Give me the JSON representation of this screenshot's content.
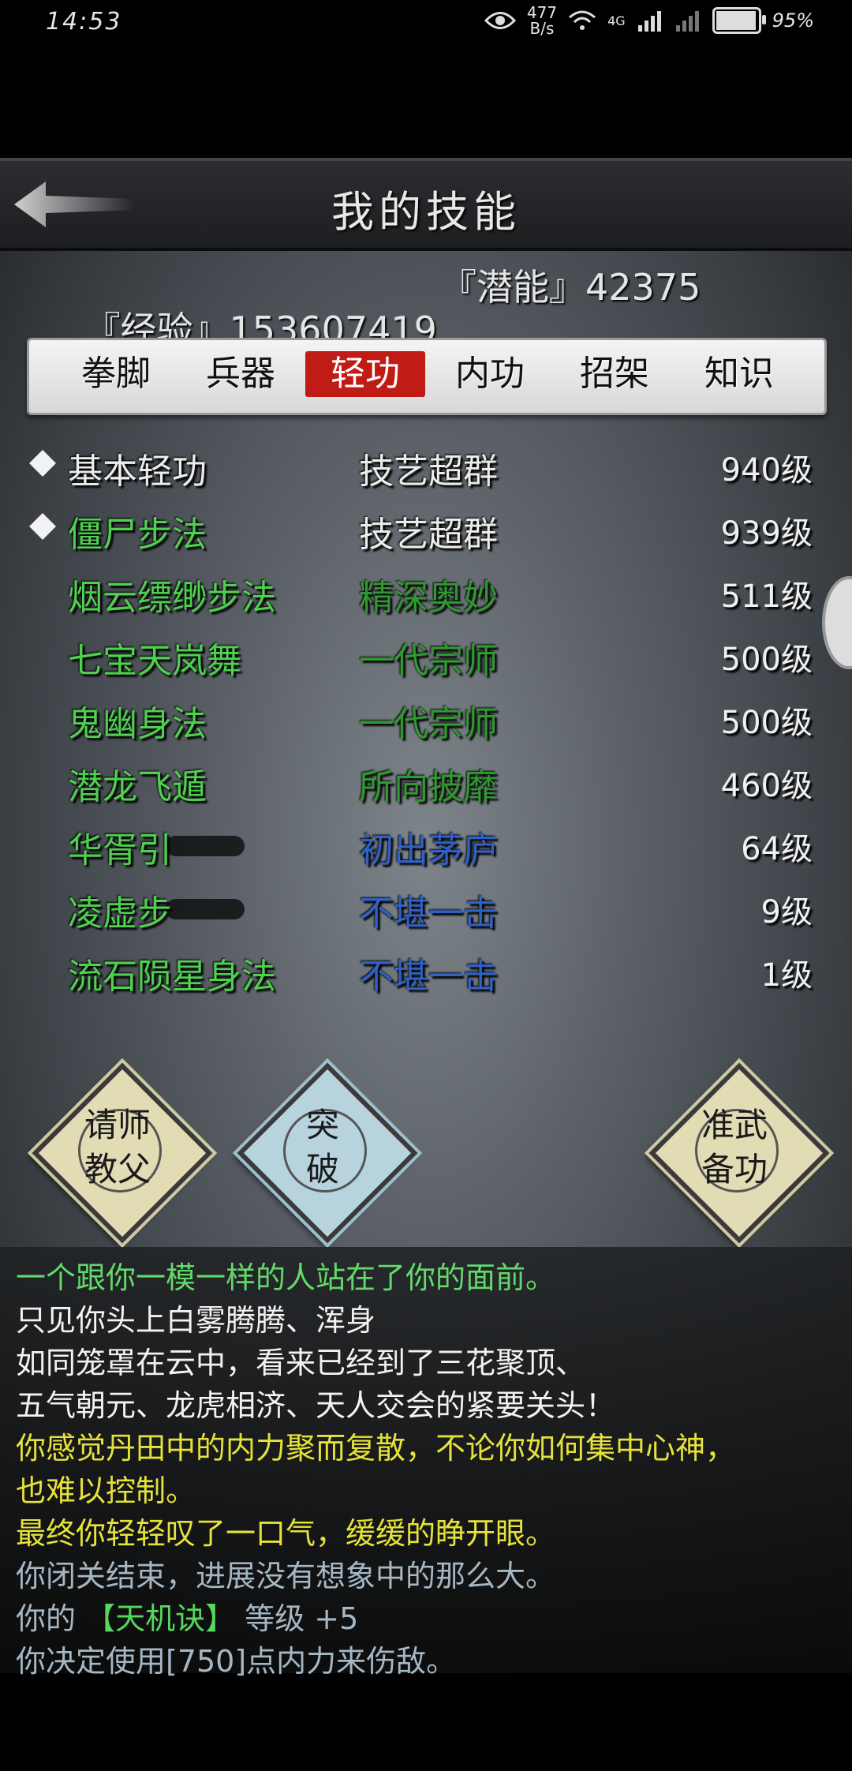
{
  "status_bar": {
    "time": "14:53",
    "net_speed": "477",
    "net_unit": "B/s",
    "signal": "4G",
    "battery": "95%",
    "battery_level": 0.95
  },
  "header": {
    "title": "我的技能"
  },
  "stats": {
    "exp": "『经验』153607419",
    "potential": "『潜能』42375"
  },
  "tabs": [
    {
      "label": "拳脚",
      "active": false
    },
    {
      "label": "兵器",
      "active": false
    },
    {
      "label": "轻功",
      "active": true
    },
    {
      "label": "内功",
      "active": false
    },
    {
      "label": "招架",
      "active": false
    },
    {
      "label": "知识",
      "active": false
    }
  ],
  "skills": [
    {
      "name": "基本轻功",
      "rank": "技艺超群",
      "level": "940级",
      "marked": true,
      "name_color": "white",
      "rank_color": "white"
    },
    {
      "name": "僵尸步法",
      "rank": "技艺超群",
      "level": "939级",
      "marked": true,
      "name_color": "green",
      "rank_color": "white"
    },
    {
      "name": "烟云缥缈步法",
      "rank": "精深奥妙",
      "level": "511级",
      "marked": false,
      "name_color": "green",
      "rank_color": "dgreen"
    },
    {
      "name": "七宝天岚舞",
      "rank": "一代宗师",
      "level": "500级",
      "marked": false,
      "name_color": "green",
      "rank_color": "dgreen"
    },
    {
      "name": "鬼幽身法",
      "rank": "一代宗师",
      "level": "500级",
      "marked": false,
      "name_color": "green",
      "rank_color": "dgreen"
    },
    {
      "name": "潜龙飞遁",
      "rank": "所向披靡",
      "level": "460级",
      "marked": false,
      "name_color": "green",
      "rank_color": "dgreen"
    },
    {
      "name": "华胥引",
      "rank": "初出茅庐",
      "level": "64级",
      "marked": false,
      "name_color": "green",
      "rank_color": "blue"
    },
    {
      "name": "凌虚步",
      "rank": "不堪一击",
      "level": "9级",
      "marked": false,
      "name_color": "green",
      "rank_color": "blue"
    },
    {
      "name": "流石陨星身法",
      "rank": "不堪一击",
      "level": "1级",
      "marked": false,
      "name_color": "green",
      "rank_color": "blue"
    }
  ],
  "buttons": {
    "ask_master": [
      "请师",
      "教父"
    ],
    "breakthrough": [
      "突",
      "破"
    ],
    "prepare": [
      "准武",
      "备功"
    ]
  },
  "log": {
    "line1": "一个跟你一模一样的人站在了你的面前。",
    "line2": "只见你头上白雾腾腾、浑身",
    "line3": "如同笼罩在云中，看来已经到了三花聚顶、",
    "line4": "五气朝元、龙虎相济、天人交会的紧要关头！",
    "line5": "你感觉丹田中的内力聚而复散，不论你如何集中心神，",
    "line6": "也难以控制。",
    "line7": "最终你轻轻叹了一口气，缓缓的睁开眼。",
    "line8": "你闭关结束，进展没有想象中的那么大。",
    "line9_prefix": "你的",
    "line9_skill": "【天机诀】",
    "line9_suffix": "等级 +5",
    "line10": "你决定使用[750]点内力来伤敌。"
  }
}
